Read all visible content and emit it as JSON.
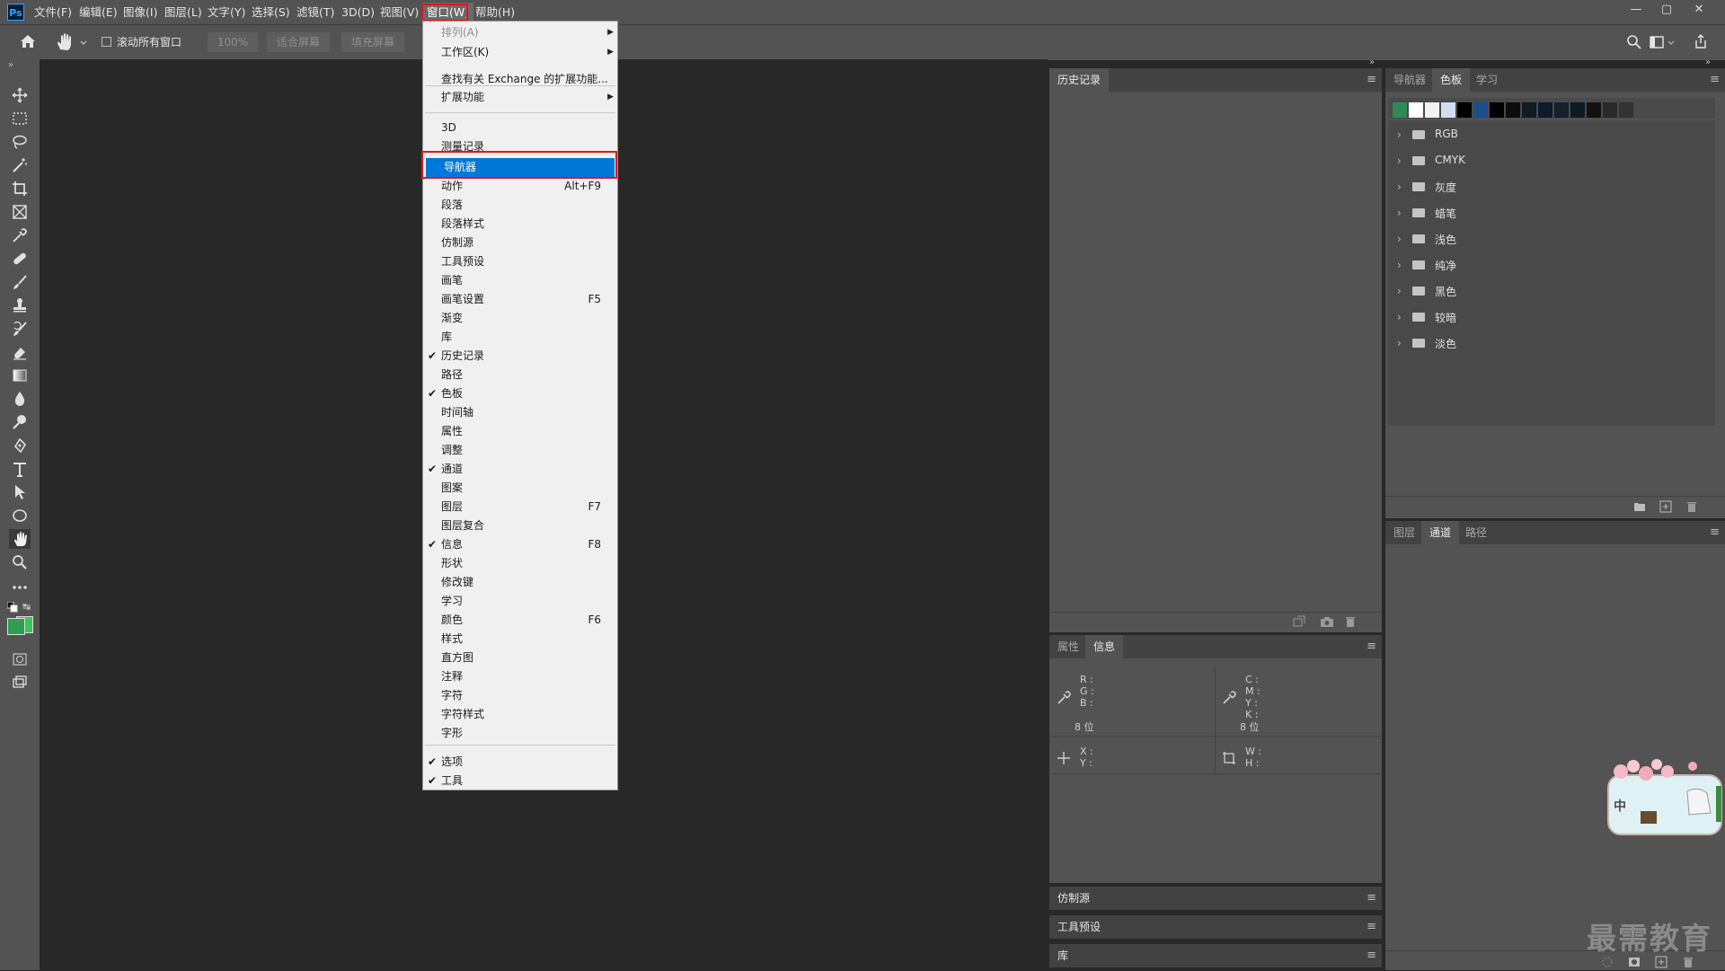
{
  "app": {
    "logo": "Ps"
  },
  "menubar": [
    {
      "label": "文件(F)"
    },
    {
      "label": "编辑(E)"
    },
    {
      "label": "图像(I)"
    },
    {
      "label": "图层(L)"
    },
    {
      "label": "文字(Y)"
    },
    {
      "label": "选择(S)"
    },
    {
      "label": "滤镜(T)"
    },
    {
      "label": "3D(D)"
    },
    {
      "label": "视图(V)"
    },
    {
      "label": "窗口(W)"
    },
    {
      "label": "帮助(H)"
    }
  ],
  "options": {
    "scroll_all_label": "滚动所有窗口",
    "zoom_value": "100%",
    "fit_screen": "适合屏幕",
    "fill_screen": "填充屏幕"
  },
  "window_menu": {
    "items": [
      {
        "label": "排列(A)",
        "submenu": true,
        "disabled": true
      },
      {
        "label": "工作区(K)",
        "submenu": true
      },
      {
        "label": "查找有关 Exchange 的扩展功能..."
      },
      {
        "label": "扩展功能",
        "submenu": true
      },
      {
        "label": "3D"
      },
      {
        "label": "测量记录"
      },
      {
        "label": "导航器",
        "highlighted": true
      },
      {
        "label": "动作",
        "shortcut": "Alt+F9"
      },
      {
        "label": "段落"
      },
      {
        "label": "段落样式"
      },
      {
        "label": "仿制源"
      },
      {
        "label": "工具预设"
      },
      {
        "label": "画笔"
      },
      {
        "label": "画笔设置",
        "shortcut": "F5"
      },
      {
        "label": "渐变"
      },
      {
        "label": "库"
      },
      {
        "label": "历史记录",
        "checked": true
      },
      {
        "label": "路径"
      },
      {
        "label": "色板",
        "checked": true
      },
      {
        "label": "时间轴"
      },
      {
        "label": "属性"
      },
      {
        "label": "调整"
      },
      {
        "label": "通道",
        "checked": true
      },
      {
        "label": "图案"
      },
      {
        "label": "图层",
        "shortcut": "F7"
      },
      {
        "label": "图层复合"
      },
      {
        "label": "信息",
        "shortcut": "F8",
        "checked": true
      },
      {
        "label": "形状"
      },
      {
        "label": "修改键"
      },
      {
        "label": "学习"
      },
      {
        "label": "颜色",
        "shortcut": "F6"
      },
      {
        "label": "样式"
      },
      {
        "label": "直方图"
      },
      {
        "label": "注释"
      },
      {
        "label": "字符"
      },
      {
        "label": "字符样式"
      },
      {
        "label": "字形"
      },
      {
        "label": "选项",
        "checked": true
      },
      {
        "label": "工具",
        "checked": true
      }
    ]
  },
  "history_panel": {
    "tab": "历史记录"
  },
  "info_panel": {
    "tabs": [
      "属性",
      "信息"
    ],
    "rgb": [
      "R :",
      "G :",
      "B :"
    ],
    "cmyk": [
      "C :",
      "M :",
      "Y :",
      "K :"
    ],
    "bits_left": "8 位",
    "bits_right": "8 位",
    "xy": [
      "X :",
      "Y :"
    ],
    "wh": [
      "W :",
      "H :"
    ]
  },
  "collapsed_panels": [
    "仿制源",
    "工具预设",
    "库"
  ],
  "swatches_panel": {
    "tabs": [
      "导航器",
      "色板",
      "学习"
    ],
    "colors": [
      "#2e8b57",
      "#ffffff",
      "#f2f2f2",
      "#d4ddf0",
      "#000000",
      "#1a4f8c",
      "#000000",
      "#0d0d0d",
      "#121a22",
      "#0d1b2a",
      "#15202c",
      "#0b1a26",
      "#111111",
      "#2a2a2a",
      "#333333"
    ],
    "folders": [
      {
        "label": "RGB"
      },
      {
        "label": "CMYK"
      },
      {
        "label": "灰度"
      },
      {
        "label": "蜡笔"
      },
      {
        "label": "浅色"
      },
      {
        "label": "纯净"
      },
      {
        "label": "黑色"
      },
      {
        "label": "较暗"
      },
      {
        "label": "淡色"
      }
    ]
  },
  "layers_panel": {
    "tabs": [
      "图层",
      "通道",
      "路径"
    ]
  },
  "colors": {
    "foreground": "#2e9e4f",
    "background": "#3cc45a",
    "highlight": "#0078d7",
    "callout": "#e0161f"
  },
  "sticker_text": "中",
  "watermark": "最需教育"
}
